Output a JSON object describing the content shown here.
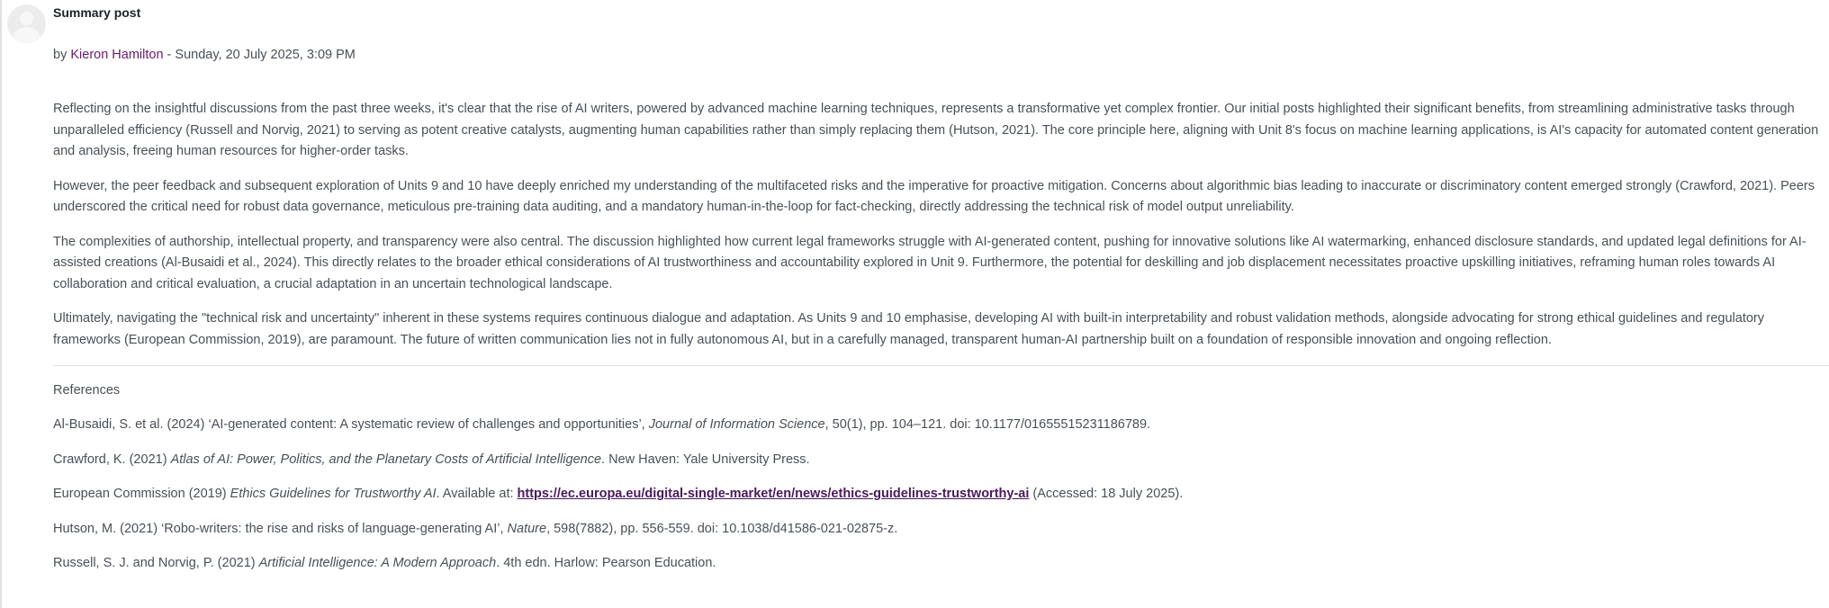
{
  "post": {
    "subject": "Summary post",
    "by_prefix": "by",
    "author": "Kieron Hamilton",
    "date_separator": " - ",
    "date": "Sunday, 20 July 2025, 3:09 PM"
  },
  "body": {
    "paragraphs": [
      "Reflecting on the insightful discussions from the past three weeks, it's clear that the rise of AI writers, powered by advanced machine learning techniques, represents a transformative yet complex frontier. Our initial posts highlighted their significant benefits, from streamlining administrative tasks through unparalleled efficiency (Russell and Norvig, 2021) to serving as potent creative catalysts, augmenting human capabilities rather than simply replacing them (Hutson, 2021). The core principle here, aligning with Unit 8's focus on machine learning applications, is AI's capacity for automated content generation and analysis, freeing human resources for higher-order tasks.",
      "However, the peer feedback and subsequent exploration of Units 9 and 10 have deeply enriched my understanding of the multifaceted risks and the imperative for proactive mitigation. Concerns about algorithmic bias leading to inaccurate or discriminatory content emerged strongly (Crawford, 2021). Peers underscored the critical need for robust data governance, meticulous pre-training data auditing, and a mandatory human-in-the-loop for fact-checking, directly addressing the technical risk of model output unreliability.",
      "The complexities of authorship, intellectual property, and transparency were also central. The discussion highlighted how current legal frameworks struggle with AI-generated content, pushing for innovative solutions like AI watermarking, enhanced disclosure standards, and updated legal definitions for AI-assisted creations (Al-Busaidi et al., 2024). This directly relates to the broader ethical considerations of AI trustworthiness and accountability explored in Unit 9. Furthermore, the potential for deskilling and job displacement necessitates proactive upskilling initiatives, reframing human roles towards AI collaboration and critical evaluation, a crucial adaptation in an uncertain technological landscape.",
      "Ultimately, navigating the \"technical risk and uncertainty\" inherent in these systems requires continuous dialogue and adaptation. As Units 9 and 10 emphasise, developing AI with built-in interpretability and robust validation methods, alongside advocating for strong ethical guidelines and regulatory frameworks (European Commission, 2019), are paramount. The future of written communication lies not in fully autonomous AI, but in a carefully managed, transparent human-AI partnership built on a foundation of responsible innovation and ongoing reflection."
    ]
  },
  "references": {
    "heading": "References",
    "items": [
      {
        "before": "Al-Busaidi, S. et al. (2024) ‘AI-generated content: A systematic review of challenges and opportunities’, ",
        "italic": "Journal of Information Science",
        "after": ", 50(1), pp. 104–121. doi: 10.1177/01655515231186789."
      },
      {
        "before": "Crawford, K. (2021) ",
        "italic": "Atlas of AI: Power, Politics, and the Planetary Costs of Artificial Intelligence",
        "after": ". New Haven: Yale University Press."
      },
      {
        "before": "European Commission (2019) ",
        "italic": "Ethics Guidelines for Trustworthy AI",
        "middle": ". Available at: ",
        "link": "https://ec.europa.eu/digital-single-market/en/news/ethics-guidelines-trustworthy-ai",
        "after": " (Accessed: 18 July 2025)."
      },
      {
        "before": "Hutson, M. (2021) ‘Robo-writers: the rise and risks of language-generating AI’, ",
        "italic": "Nature",
        "after": ", 598(7882), pp. 556-559. doi: 10.1038/d41586-021-02875-z."
      },
      {
        "before": "Russell, S. J. and Norvig, P. (2021) ",
        "italic": "Artificial Intelligence: A Modern Approach",
        "after": ". 4th edn. Harlow: Pearson Education."
      }
    ]
  },
  "colors": {
    "author_link": "#6a1b6a",
    "reference_link": "#4a1a5c",
    "body_text": "#495057",
    "subject_text": "#1d2125"
  },
  "icons": {
    "avatar": "default-user-avatar-icon"
  }
}
